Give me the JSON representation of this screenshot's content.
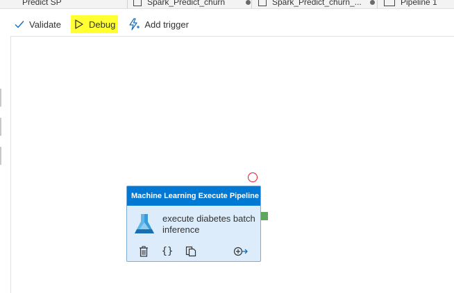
{
  "tabs": [
    {
      "label": "Predict SP"
    },
    {
      "label": "Spark_Predict_churn"
    },
    {
      "label": "Spark_Predict_churn_..."
    },
    {
      "label": "Pipeline 1"
    }
  ],
  "toolbar": {
    "validate_label": "Validate",
    "debug_label": "Debug",
    "add_trigger_label": "Add trigger"
  },
  "activity": {
    "type_label": "Machine Learning Execute Pipeline",
    "name": "execute diabetes batch inference",
    "header_color": "#0078d4",
    "body_color": "#dcecfa",
    "icon": "machine-learning-flask-icon",
    "actions": [
      "delete-icon",
      "code-icon",
      "copy-icon",
      "add-output-icon"
    ]
  },
  "colors": {
    "debug_highlight": "#ffff32",
    "failure_port": "#e81123",
    "success_port": "#5ea85e"
  }
}
